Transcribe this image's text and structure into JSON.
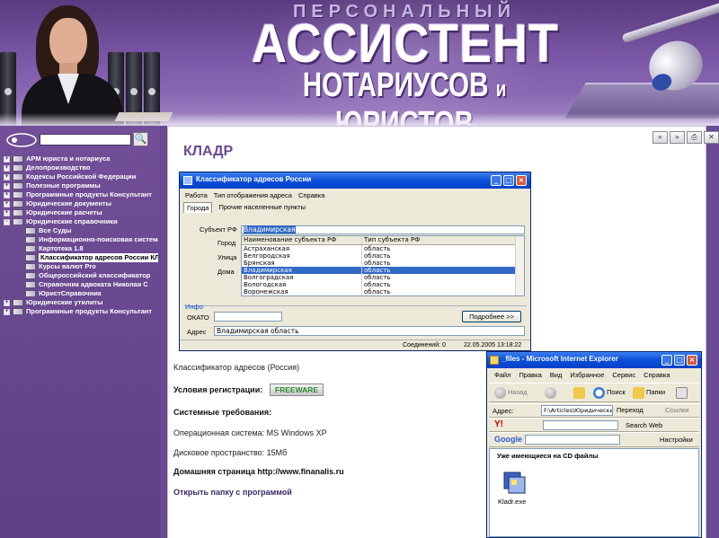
{
  "header": {
    "line1": "ПЕРСОНАЛЬНЫЙ",
    "line2": "АССИСТЕНТ",
    "line3a": "НОТАРИУСОВ",
    "line3b": "и",
    "line3c": "ЮРИСТОВ",
    "search_icon": "search-icon"
  },
  "sidebar": {
    "items": [
      {
        "label": "АРМ юриста и нотариуса",
        "expander": "+"
      },
      {
        "label": "Делопроизводство",
        "expander": "+"
      },
      {
        "label": "Кодексы Российской Федерации",
        "expander": "+"
      },
      {
        "label": "Полезные программы",
        "expander": "+"
      },
      {
        "label": "Программные продукты Консультант",
        "expander": "+"
      },
      {
        "label": "Юридические документы",
        "expander": "+"
      },
      {
        "label": "Юридические расчеты",
        "expander": "+"
      },
      {
        "label": "Юридические справочники",
        "expander": "-"
      },
      {
        "label": "Все Суды",
        "sub": true
      },
      {
        "label": "Информационно-поисковая система",
        "sub": true
      },
      {
        "label": "Картотека 1.8",
        "sub": true
      },
      {
        "label": "Классификатор адресов России КЛАДР",
        "sub": true,
        "selected": true
      },
      {
        "label": "Курсы валют Pro",
        "sub": true
      },
      {
        "label": "Общероссийский классификатор",
        "sub": true
      },
      {
        "label": "Справочник адвоката Николая С",
        "sub": true
      },
      {
        "label": "ЮристСправочник",
        "sub": true
      },
      {
        "label": "Юридические утилиты",
        "expander": "+"
      },
      {
        "label": "Программные продукты Консультант",
        "expander": "+"
      }
    ]
  },
  "content": {
    "title": "КЛАДР",
    "nav": [
      "«",
      "»",
      "⎙",
      "✕"
    ],
    "desc": "Классификатор адресов (Россия)",
    "reg_label": "Условия регистрации:",
    "reg_value": "FREEWARE",
    "req_title": "Системные требования:",
    "os": "Операционная система: MS Windows XP",
    "disk": "Дисковое пространство: 15Мб",
    "homepage": "Домашняя страница http://www.finanalis.ru",
    "open_folder": "Открыть папку с программой"
  },
  "dialog": {
    "title": "Классификатор адресов России",
    "menu": [
      "Работа",
      "Тип отображения адреса",
      "Справка"
    ],
    "tabs": [
      "Города",
      "Прочие населенные пункты"
    ],
    "labels": {
      "subject": "Субъект РФ",
      "city": "Город",
      "street": "Улица",
      "house": "Дома",
      "info": "Инфо",
      "okato": "ОКАТО",
      "address": "Адрес"
    },
    "subject_value": "Владимирская",
    "list_headers": [
      "Наименование субъекта РФ",
      "Тип субъекта РФ"
    ],
    "list_rows": [
      [
        "Астраханская",
        "область"
      ],
      [
        "Белгородская",
        "область"
      ],
      [
        "Брянская",
        "область"
      ],
      [
        "Владимирская",
        "область"
      ],
      [
        "Волгоградская",
        "область"
      ],
      [
        "Вологодская",
        "область"
      ],
      [
        "Воронежская",
        "область"
      ]
    ],
    "selected_row": 3,
    "more_button": "Подробнее >>",
    "address_value": "Владимирская область",
    "status_conn": "Соединений: 0",
    "status_date": "22.05.2005 13:18:22"
  },
  "explorer": {
    "title": "_files - Microsoft Internet Explorer",
    "menu": [
      "Файл",
      "Правка",
      "Вид",
      "Избранное",
      "Сервис",
      "Справка"
    ],
    "back": "Назад",
    "search": "Поиск",
    "folders": "Папки",
    "address_label": "Адрес:",
    "address_value": "F:\\Articles\\Юридические сп",
    "go": "Переход",
    "links": "Ссылки",
    "yahoo_search": "Search Web",
    "google_settings": "Настройки",
    "banner": "Уже имеющиеся на CD файлы",
    "file_name": "Kladr.exe"
  },
  "colors": {
    "accent": "#6b4a93",
    "sidebar": "#68468e",
    "xp_blue": "#0a4fd8"
  }
}
